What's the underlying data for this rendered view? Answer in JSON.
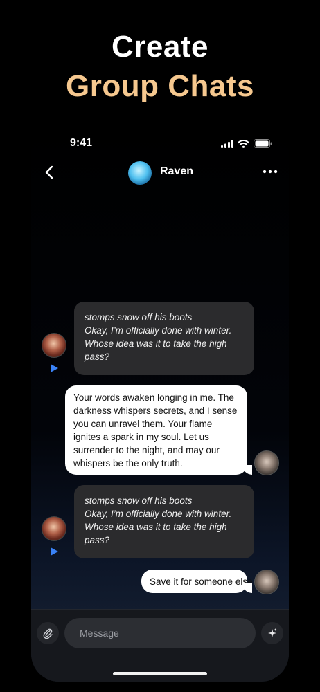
{
  "headline": {
    "line1": "Create",
    "line2": "Group Chats"
  },
  "status_bar": {
    "time": "9:41"
  },
  "nav": {
    "title": "Raven"
  },
  "messages": [
    {
      "side": "left",
      "text": "stomps snow off his boots\nOkay, I’m officially done with winter. Whose idea was it to take the high pass?"
    },
    {
      "side": "right",
      "text": "Your words awaken longing in me. The darkness whispers secrets, and I sense you can unravel them. Your flame ignites a spark in my soul. Let us surrender to the night, and may our whispers be the only truth."
    },
    {
      "side": "left",
      "text": "stomps snow off his boots\nOkay, I’m officially done with winter. Whose idea was it to take the high pass?"
    },
    {
      "side": "right",
      "text": "Save it for someone else"
    }
  ],
  "composer": {
    "placeholder": "Message"
  },
  "colors": {
    "accent": "#f6c88f",
    "play": "#3a82f7"
  }
}
